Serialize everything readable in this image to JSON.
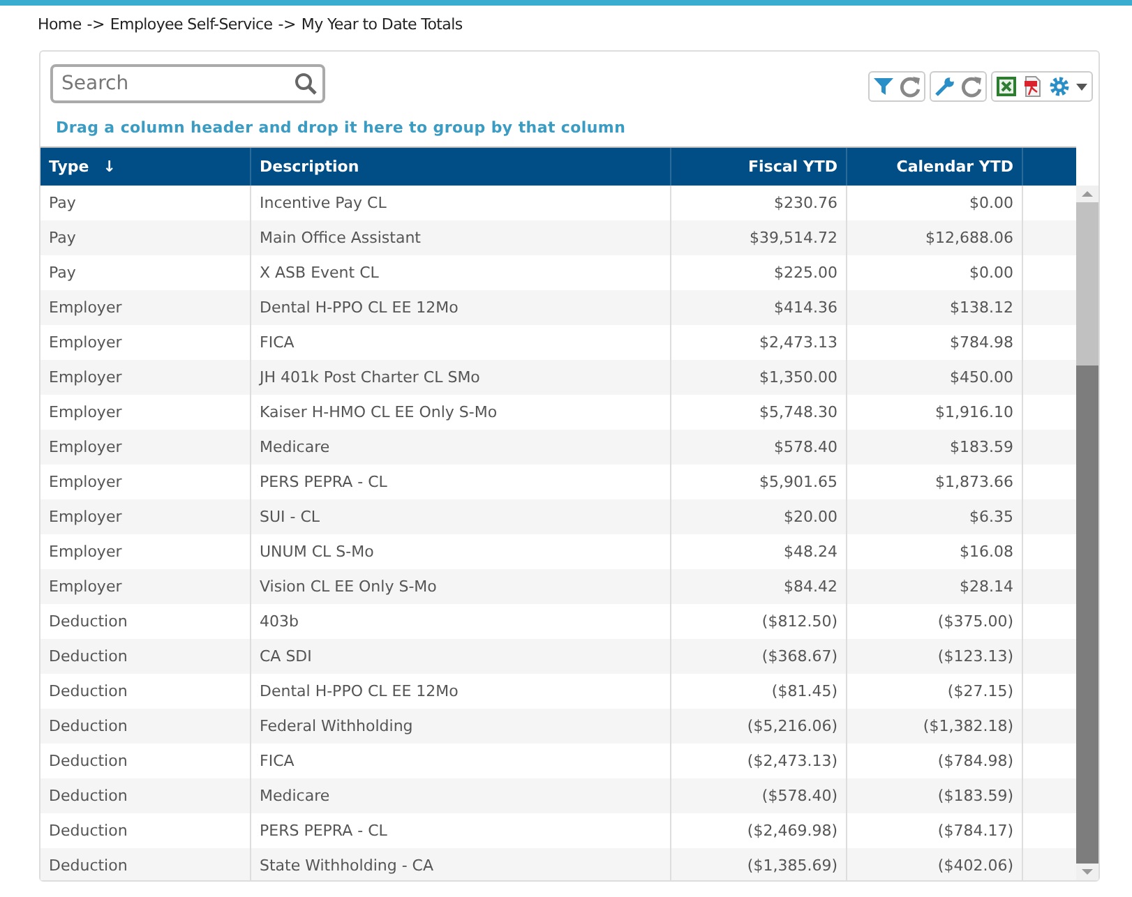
{
  "breadcrumb": {
    "items": [
      "Home",
      "Employee Self-Service",
      "My Year to Date Totals"
    ],
    "separator": "->"
  },
  "search": {
    "placeholder": "Search"
  },
  "toolbar": [
    {
      "kind": "filter"
    },
    {
      "kind": "refresh"
    },
    {
      "kind": "gap"
    },
    {
      "kind": "wrench"
    },
    {
      "kind": "refresh"
    },
    {
      "kind": "gap"
    },
    {
      "kind": "excel"
    },
    {
      "kind": "pdf"
    },
    {
      "kind": "gear"
    },
    {
      "kind": "caret"
    }
  ],
  "group_hint": "Drag a column header and drop it here to group by that column",
  "table": {
    "columns": [
      {
        "label": "Type",
        "sort_mark": "↓",
        "kind": "text"
      },
      {
        "label": "Description",
        "kind": "text"
      },
      {
        "label": "Fiscal YTD",
        "kind": "amount"
      },
      {
        "label": "Calendar YTD",
        "kind": "amount"
      }
    ],
    "rows": [
      [
        "Pay",
        "Incentive Pay CL",
        "$230.76",
        "$0.00"
      ],
      [
        "Pay",
        "Main Office Assistant",
        "$39,514.72",
        "$12,688.06"
      ],
      [
        "Pay",
        "X ASB Event CL",
        "$225.00",
        "$0.00"
      ],
      [
        "Employer",
        "Dental H-PPO CL EE 12Mo",
        "$414.36",
        "$138.12"
      ],
      [
        "Employer",
        "FICA",
        "$2,473.13",
        "$784.98"
      ],
      [
        "Employer",
        "JH 401k Post Charter CL SMo",
        "$1,350.00",
        "$450.00"
      ],
      [
        "Employer",
        "Kaiser H-HMO CL EE Only S-Mo",
        "$5,748.30",
        "$1,916.10"
      ],
      [
        "Employer",
        "Medicare",
        "$578.40",
        "$183.59"
      ],
      [
        "Employer",
        "PERS PEPRA - CL",
        "$5,901.65",
        "$1,873.66"
      ],
      [
        "Employer",
        "SUI - CL",
        "$20.00",
        "$6.35"
      ],
      [
        "Employer",
        "UNUM CL S-Mo",
        "$48.24",
        "$16.08"
      ],
      [
        "Employer",
        "Vision CL EE Only S-Mo",
        "$84.42",
        "$28.14"
      ],
      [
        "Deduction",
        "403b",
        "($812.50)",
        "($375.00)"
      ],
      [
        "Deduction",
        "CA SDI",
        "($368.67)",
        "($123.13)"
      ],
      [
        "Deduction",
        "Dental H-PPO CL EE 12Mo",
        "($81.45)",
        "($27.15)"
      ],
      [
        "Deduction",
        "Federal Withholding",
        "($5,216.06)",
        "($1,382.18)"
      ],
      [
        "Deduction",
        "FICA",
        "($2,473.13)",
        "($784.98)"
      ],
      [
        "Deduction",
        "Medicare",
        "($578.40)",
        "($183.59)"
      ],
      [
        "Deduction",
        "PERS PEPRA - CL",
        "($2,469.98)",
        "($784.17)"
      ],
      [
        "Deduction",
        "State Withholding - CA",
        "($1,385.69)",
        "($402.06)"
      ]
    ]
  }
}
